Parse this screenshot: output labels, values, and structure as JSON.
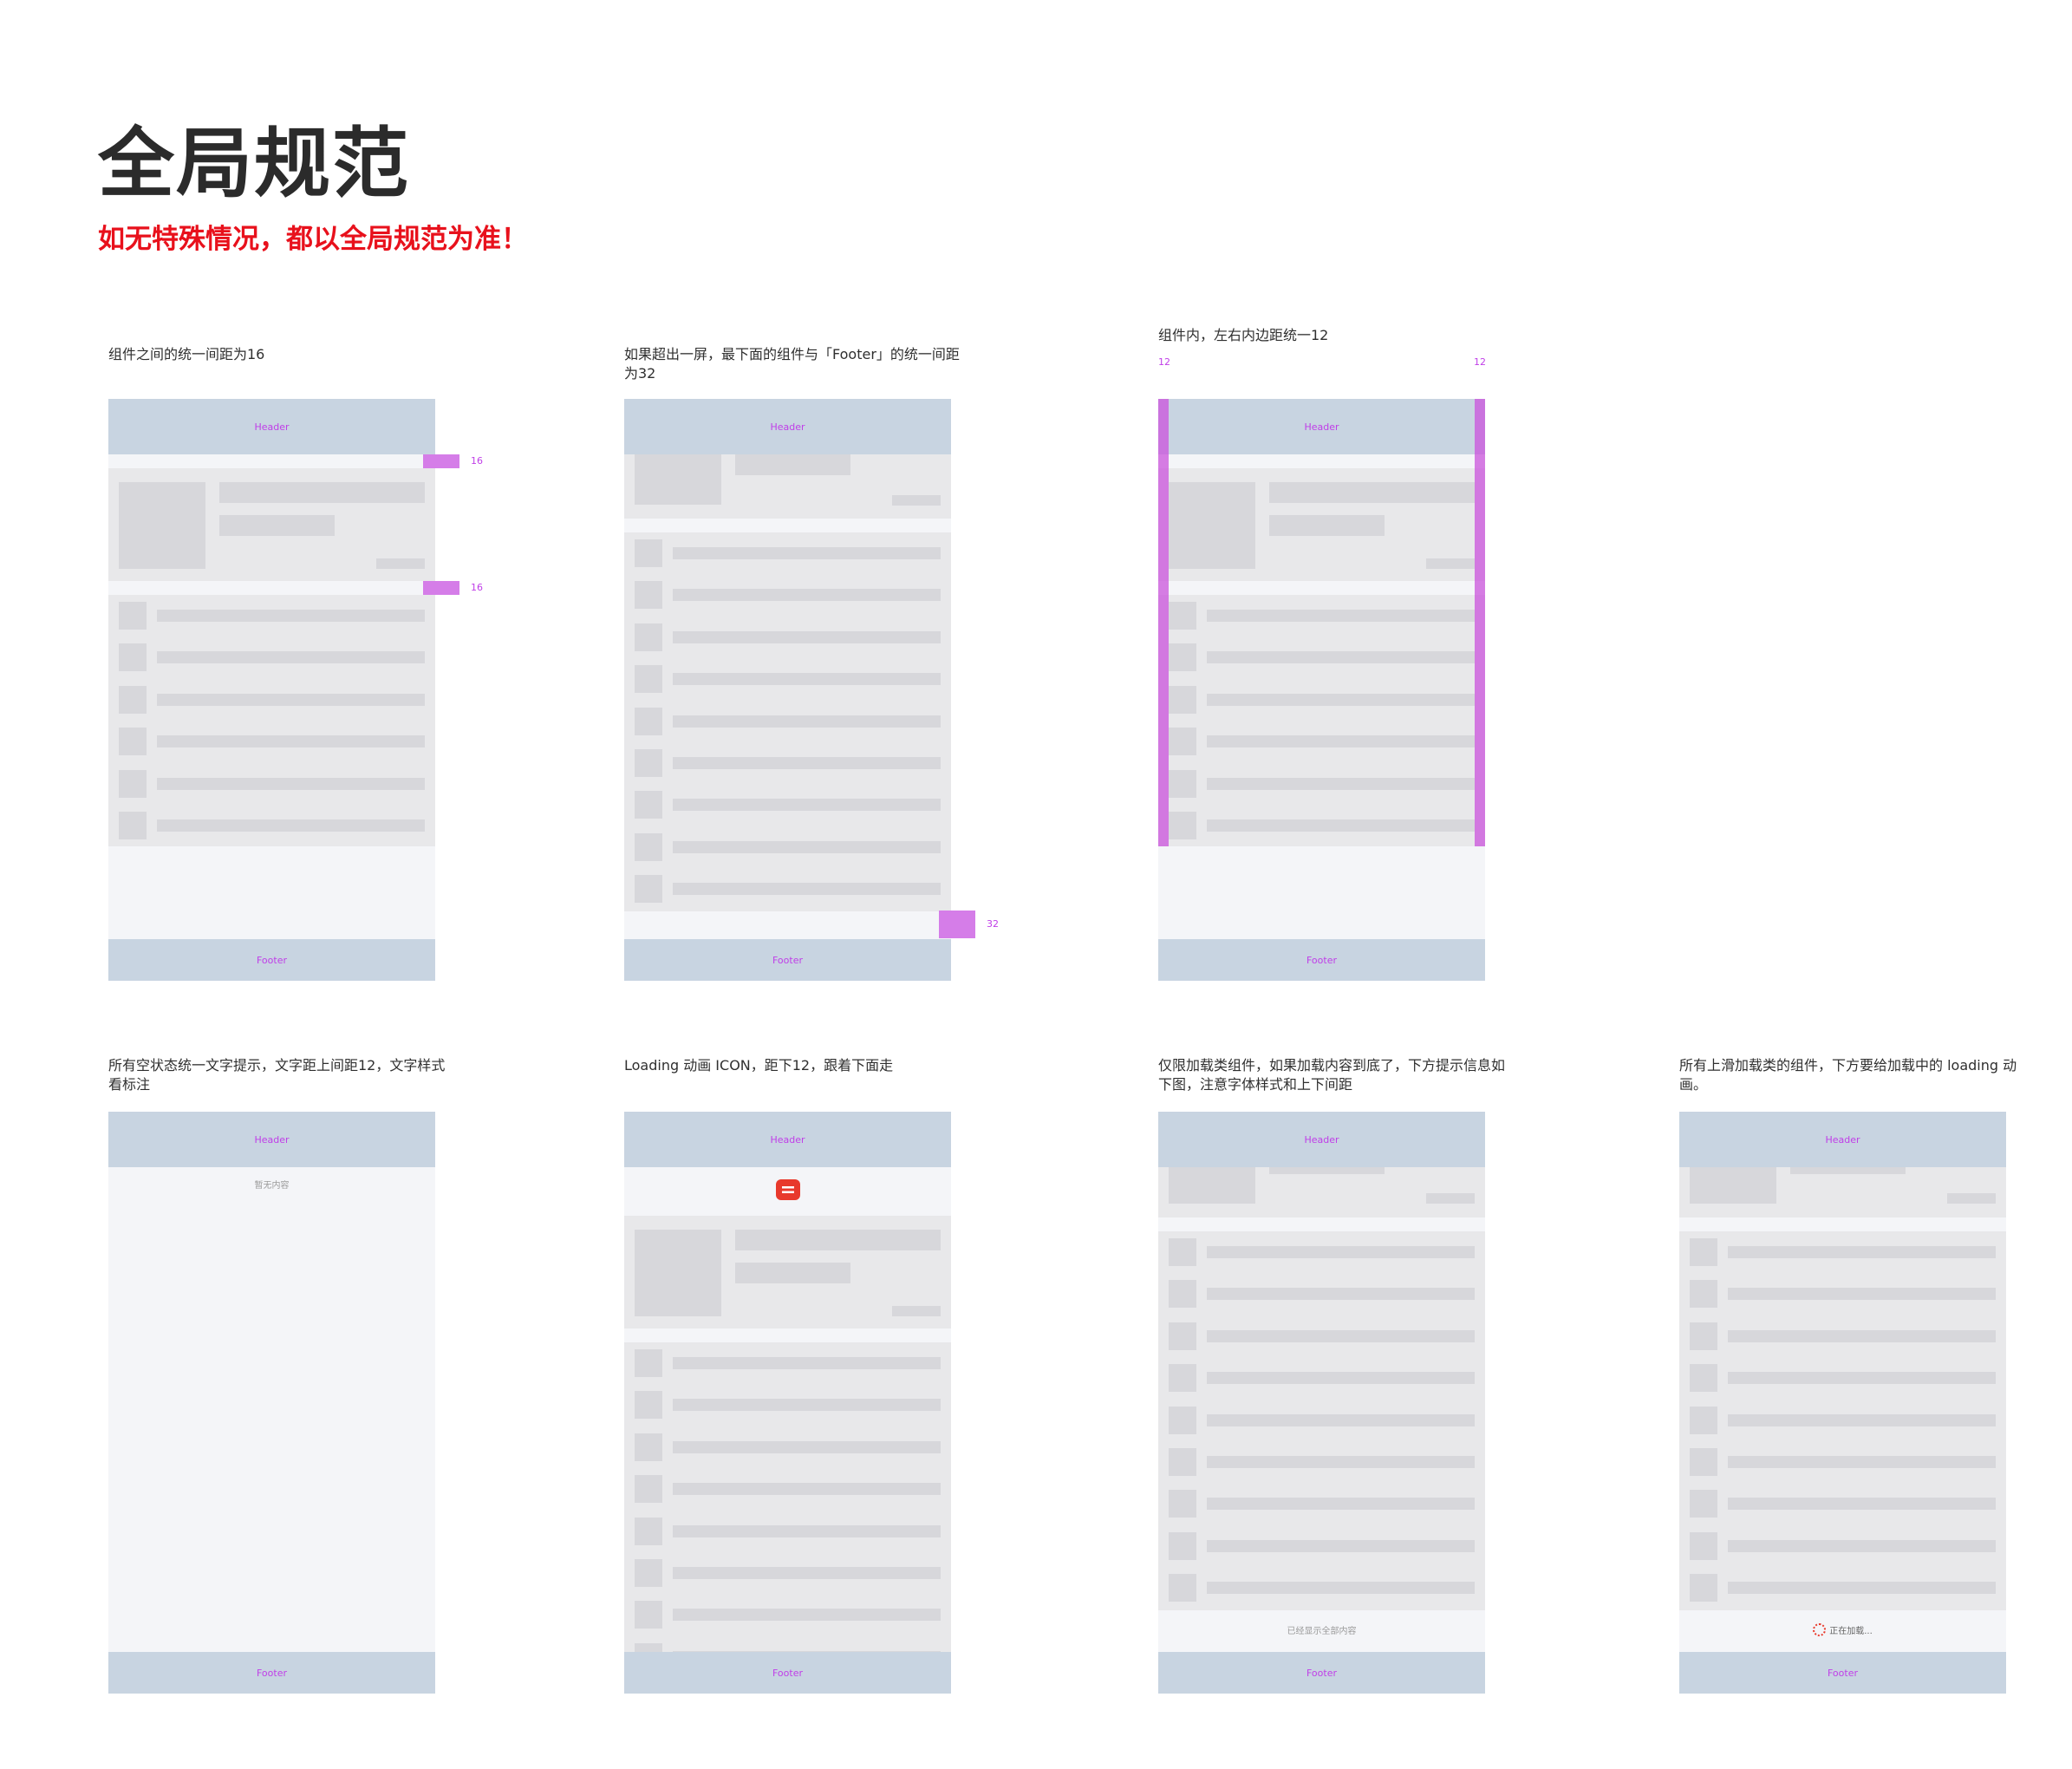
{
  "page": {
    "title": "全局规范",
    "subtitle": "如无特殊情况，都以全局规范为准！"
  },
  "panels": {
    "p1": {
      "desc": "组件之间的统一间距为16",
      "header": "Header",
      "footer": "Footer",
      "gap1_label": "16",
      "gap2_label": "16"
    },
    "p2": {
      "desc": "如果超出一屏，最下面的组件与「Footer」的统一间距为32",
      "header": "Header",
      "footer": "Footer",
      "gap_label": "32"
    },
    "p3": {
      "desc": "组件内，左右内边距统一12",
      "header": "Header",
      "footer": "Footer",
      "left_label": "12",
      "right_label": "12"
    },
    "p4": {
      "desc": "所有空状态统一文字提示，文字距上间距12，文字样式看标注",
      "header": "Header",
      "footer": "Footer",
      "empty_text": "暂无内容"
    },
    "p5": {
      "desc": "Loading 动画 ICON，距下12，跟着下面走",
      "header": "Header",
      "footer": "Footer",
      "loading_icon": "loading-icon"
    },
    "p6": {
      "desc": "仅限加载类组件，如果加载内容到底了，下方提示信息如下图，注意字体样式和上下间距",
      "header": "Header",
      "footer": "Footer",
      "end_text": "已经显示全部内容"
    },
    "p7": {
      "desc": "所有上滑加载类的组件，下方要给加载中的 loading 动画。",
      "header": "Header",
      "footer": "Footer",
      "loading_text": "正在加载..."
    }
  },
  "colors": {
    "header_bg": "#c8d4e1",
    "marker": "#d57de8",
    "label": "#c03ee8",
    "subtitle": "#e8111c",
    "loading_icon": "#e8392c"
  }
}
